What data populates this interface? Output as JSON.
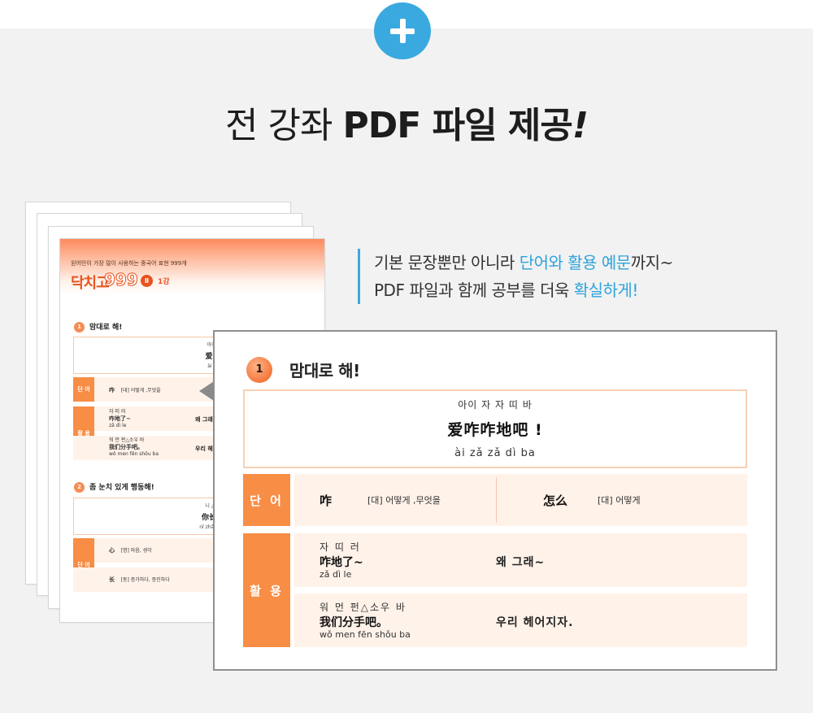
{
  "headline": {
    "light": "전 강좌 ",
    "bold": "PDF 파일 제공",
    "mark": "!"
  },
  "description": {
    "line1_plain": "기본 문장뿐만 아니라 ",
    "line1_highlight": "단어와 활용 예문",
    "line1_tail": "까지~",
    "line2_plain": "PDF 파일과 함께 공부를 더욱 ",
    "line2_highlight": "확실하게!"
  },
  "colors": {
    "accent_blue": "#3aa9df",
    "accent_orange": "#f88d45"
  },
  "icons": {
    "plus": "plus-icon"
  },
  "mini_page": {
    "subtitle": "원어민이 가장 많이 사용하는 중국어 표현 999개",
    "title": "닥치고",
    "number": "999",
    "roman": "Ⅱ",
    "lesson": "1강",
    "section1": {
      "num": "1",
      "title": "맘대로 해!",
      "pron": "아이 자 자 띠 바",
      "zh": "爱咋咋地吧",
      "py": "ài zǎ zǎ dì ba"
    },
    "word_label": "단 어",
    "use_label": "활 용",
    "word1": {
      "zh": "咋",
      "mean": "[대] 어떻게 ,무엇을"
    },
    "use1": {
      "pron": "자 띠 러",
      "zh": "咋地了~",
      "py": "zǎ dì le",
      "ko": "왜 그래"
    },
    "use2": {
      "pron": "워 먼 펀△소우 바",
      "zh": "我们分手吧。",
      "py": "wǒ men fēn shǒu ba",
      "ko": "우리 헤"
    },
    "section2": {
      "num": "2",
      "title": "좀 눈치 있게 행동해!",
      "pron": "니 △장 디엔 얼 씬",
      "zh": "你长点儿心吧",
      "py": "nǐ zhǎng diǎn er xīn"
    },
    "word2a": {
      "zh": "心",
      "mean": "[명] 마음, 생각"
    },
    "word2b": {
      "zh": "长",
      "mean": "[동] 증가하다, 증진하다"
    }
  },
  "card": {
    "num": "1",
    "title": "맘대로 해!",
    "pron": "아이 자 자 띠 바",
    "zh": "爱咋咋地吧 !",
    "py": "ài zǎ zǎ dì ba",
    "word_label": "단 어",
    "use_label": "활 용",
    "words": [
      {
        "zh": "咋",
        "mean": "[대] 어떻게 ,무엇을"
      },
      {
        "zh": "怎么",
        "mean": "[대] 어떻게"
      }
    ],
    "uses": [
      {
        "pron": "자 띠 러",
        "zh": "咋地了~",
        "py": "zǎ dì le",
        "ko": "왜 그래~"
      },
      {
        "pron": "워 먼 펀△소우 바",
        "zh": "我们分手吧。",
        "py": "wǒ men fēn shǒu ba",
        "ko": "우리 헤어지자."
      }
    ]
  }
}
